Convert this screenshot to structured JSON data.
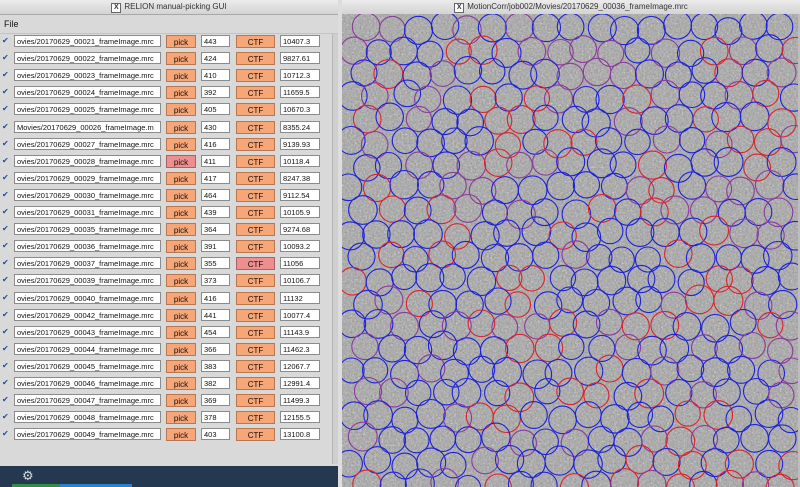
{
  "left_window": {
    "title": "RELION manual-picking GUI",
    "menu": "File",
    "rows": [
      {
        "file": "ovies/20170629_00021_frameImage.mrc",
        "pick": "pick",
        "count": "443",
        "ctf": "CTF",
        "defocus": "10407.3"
      },
      {
        "file": "ovies/20170629_00022_frameImage.mrc",
        "pick": "pick",
        "count": "424",
        "ctf": "CTF",
        "defocus": "9827.61"
      },
      {
        "file": "ovies/20170629_00023_frameImage.mrc",
        "pick": "pick",
        "count": "410",
        "ctf": "CTF",
        "defocus": "10712.3"
      },
      {
        "file": "ovies/20170629_00024_frameImage.mrc",
        "pick": "pick",
        "count": "392",
        "ctf": "CTF",
        "defocus": "11659.5"
      },
      {
        "file": "ovies/20170629_00025_frameImage.mrc",
        "pick": "pick",
        "count": "405",
        "ctf": "CTF",
        "defocus": "10670.3"
      },
      {
        "file": "Movies/20170629_00026_frameImage.m",
        "pick": "pick",
        "count": "430",
        "ctf": "CTF",
        "defocus": "8355.24"
      },
      {
        "file": "ovies/20170629_00027_frameImage.mrc",
        "pick": "pick",
        "count": "416",
        "ctf": "CTF",
        "defocus": "9139.93"
      },
      {
        "file": "ovies/20170629_00028_frameImage.mrc",
        "pick": "pick",
        "count": "411",
        "ctf": "CTF",
        "defocus": "10118.4"
      },
      {
        "file": "ovies/20170629_00029_frameImage.mrc",
        "pick": "pick",
        "count": "417",
        "ctf": "CTF",
        "defocus": "8247.38"
      },
      {
        "file": "ovies/20170629_00030_frameImage.mrc",
        "pick": "pick",
        "count": "464",
        "ctf": "CTF",
        "defocus": "9112.54"
      },
      {
        "file": "ovies/20170629_00031_frameImage.mrc",
        "pick": "pick",
        "count": "439",
        "ctf": "CTF",
        "defocus": "10105.9"
      },
      {
        "file": "ovies/20170629_00035_frameImage.mrc",
        "pick": "pick",
        "count": "364",
        "ctf": "CTF",
        "defocus": "9274.68"
      },
      {
        "file": "ovies/20170629_00036_frameImage.mrc",
        "pick": "pick",
        "count": "391",
        "ctf": "CTF",
        "defocus": "10093.2"
      },
      {
        "file": "ovies/20170629_00037_frameImage.mrc",
        "pick": "pick",
        "count": "355",
        "ctf": "CTF",
        "defocus": "11056"
      },
      {
        "file": "ovies/20170629_00039_frameImage.mrc",
        "pick": "pick",
        "count": "373",
        "ctf": "CTF",
        "defocus": "10106.7"
      },
      {
        "file": "ovies/20170629_00040_frameImage.mrc",
        "pick": "pick",
        "count": "416",
        "ctf": "CTF",
        "defocus": "11132"
      },
      {
        "file": "ovies/20170629_00042_frameImage.mrc",
        "pick": "pick",
        "count": "441",
        "ctf": "CTF",
        "defocus": "10077.4"
      },
      {
        "file": "ovies/20170629_00043_frameImage.mrc",
        "pick": "pick",
        "count": "454",
        "ctf": "CTF",
        "defocus": "11143.9"
      },
      {
        "file": "ovies/20170629_00044_frameImage.mrc",
        "pick": "pick",
        "count": "366",
        "ctf": "CTF",
        "defocus": "11462.3"
      },
      {
        "file": "ovies/20170629_00045_frameImage.mrc",
        "pick": "pick",
        "count": "383",
        "ctf": "CTF",
        "defocus": "12067.7"
      },
      {
        "file": "ovies/20170629_00046_frameImage.mrc",
        "pick": "pick",
        "count": "382",
        "ctf": "CTF",
        "defocus": "12991.4"
      },
      {
        "file": "ovies/20170629_00047_frameImage.mrc",
        "pick": "pick",
        "count": "369",
        "ctf": "CTF",
        "defocus": "11499.3"
      },
      {
        "file": "ovies/20170629_00048_frameImage.mrc",
        "pick": "pick",
        "count": "378",
        "ctf": "CTF",
        "defocus": "12155.5"
      },
      {
        "file": "ovies/20170629_00049_frameImage.mrc",
        "pick": "pick",
        "count": "403",
        "ctf": "CTF",
        "defocus": "13100.8"
      }
    ],
    "active_pick_row": 7,
    "active_ctf_row": 13
  },
  "right_window": {
    "title": "MotionCorr/job002/Movies/20170629_00036_frameImage.mrc"
  },
  "icons": {
    "checkbox": "checkmark-icon",
    "window": "x11-window-icon",
    "settings": "gear-icon"
  },
  "colors": {
    "button": "#f6a677",
    "button_active": "#ee8f8f",
    "circle_blue": "#1d22d6",
    "circle_red": "#d8242c",
    "circle_purple": "#8a3c9a"
  }
}
